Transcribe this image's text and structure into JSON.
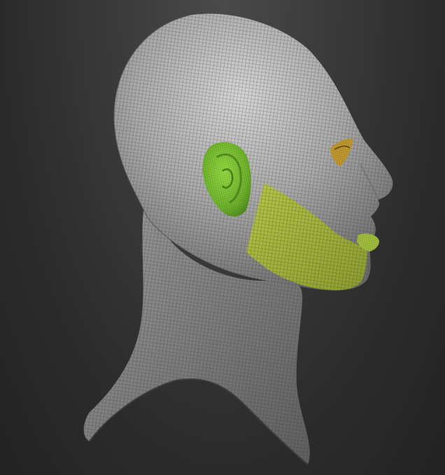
{
  "viewport": {
    "background_top": "#4a4a4a",
    "background_bottom": "#232323"
  },
  "model": {
    "subject": "head-and-neck-sculpt",
    "view": "right-profile",
    "display_mode": "polyframe-wireframe",
    "base_color": "#b9b9b9",
    "wire_color": "#3a3a3a",
    "polygroups": [
      {
        "id": "ear",
        "color": "#7cc230"
      },
      {
        "id": "jaw-cheek",
        "color": "#a6b73a"
      },
      {
        "id": "lips",
        "color": "#a2c23c"
      },
      {
        "id": "eye",
        "color": "#c49a2c"
      }
    ]
  }
}
